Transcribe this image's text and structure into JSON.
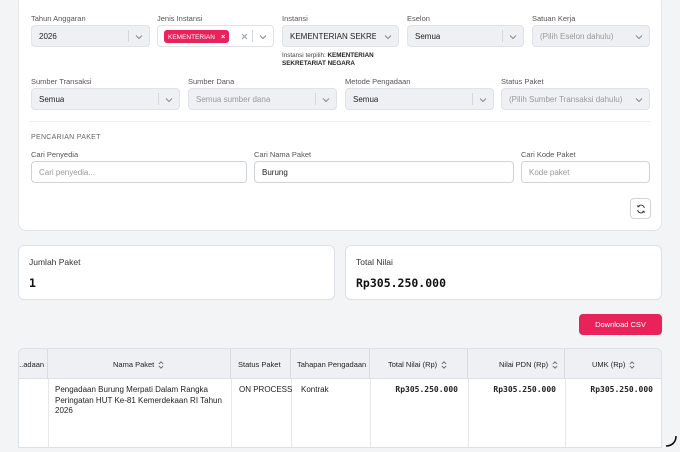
{
  "filters": {
    "tahun_anggaran": {
      "label": "Tahun Anggaran",
      "value": "2026"
    },
    "jenis_instansi": {
      "label": "Jenis Instansi",
      "tag": "KEMENTERIAN",
      "tag_remove": "×"
    },
    "instansi": {
      "label": "Instansi",
      "value": "KEMENTERIAN SEKRETA...",
      "hint_prefix": "Instansi terpilih:",
      "hint_value_line1": "KEMENTERIAN",
      "hint_value_line2": "SEKRETARIAT NEGARA"
    },
    "eselon": {
      "label": "Eselon",
      "value": "Semua"
    },
    "satuan_kerja": {
      "label": "Satuan Kerja",
      "placeholder": "(Pilih Eselon dahulu)"
    },
    "sumber_transaksi": {
      "label": "Sumber Transaksi",
      "value": "Semua"
    },
    "sumber_dana": {
      "label": "Sumber Dana",
      "placeholder": "Semua sumber dana"
    },
    "metode_pengadaan": {
      "label": "Metode Pengadaan",
      "value": "Semua"
    },
    "status_paket": {
      "label": "Status Paket",
      "placeholder": "(Pilih Sumber Transaksi dahulu)"
    }
  },
  "search": {
    "section_title": "PENCARIAN PAKET",
    "penyedia": {
      "label": "Cari Penyedia",
      "placeholder": "Cari penyedia...",
      "value": ""
    },
    "nama_paket": {
      "label": "Cari Nama Paket",
      "placeholder": "",
      "value": "Burung"
    },
    "kode_paket": {
      "label": "Cari Kode Paket",
      "placeholder": "Kode paket",
      "value": ""
    }
  },
  "stats": {
    "jumlah_paket": {
      "label": "Jumlah Paket",
      "value": "1"
    },
    "total_nilai": {
      "label": "Total Nilai",
      "value": "Rp305.250.000"
    }
  },
  "download_label": "Download CSV",
  "table": {
    "columns": [
      "...adaan",
      "Nama Paket",
      "Status Paket",
      "Tahapan Pengadaan",
      "Total Nilai (Rp)",
      "Nilai PDN (Rp)",
      "UMK (Rp)"
    ],
    "rows": [
      {
        "nama_paket_line1": "Pengadaan Burung Merpati Dalam Rangka",
        "nama_paket_line2": "Peringatan HUT Ke-81 Kemerdekaan RI Tahun",
        "nama_paket_line3": "2026",
        "status_paket": "ON PROCESS",
        "tahapan": "Kontrak",
        "total_nilai": "Rp305.250.000",
        "nilai_pdn": "Rp305.250.000",
        "umk": "Rp305.250.000"
      }
    ]
  }
}
